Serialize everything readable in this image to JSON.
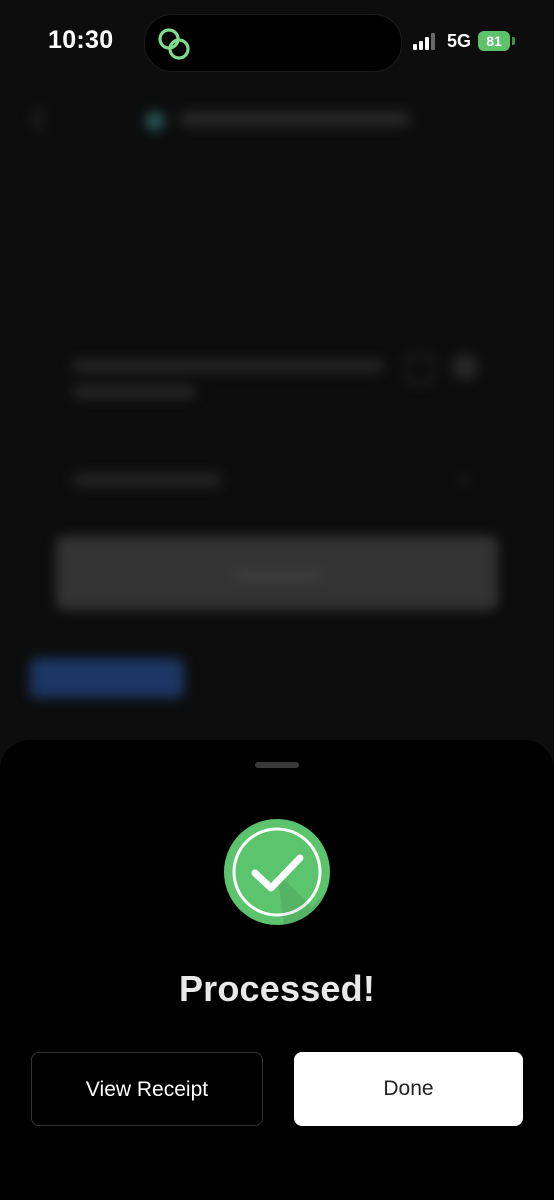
{
  "status_bar": {
    "time": "10:30",
    "network": "5G",
    "battery": "81",
    "battery_color": "#5ec26a"
  },
  "island": {
    "icon": "linked-rings-icon",
    "icon_color": "#7fdc8a"
  },
  "sheet": {
    "title": "Processed!",
    "success_icon": "checkmark-circle-icon",
    "success_color": "#5cc46c",
    "buttons": {
      "view_receipt": "View Receipt",
      "done": "Done"
    }
  }
}
